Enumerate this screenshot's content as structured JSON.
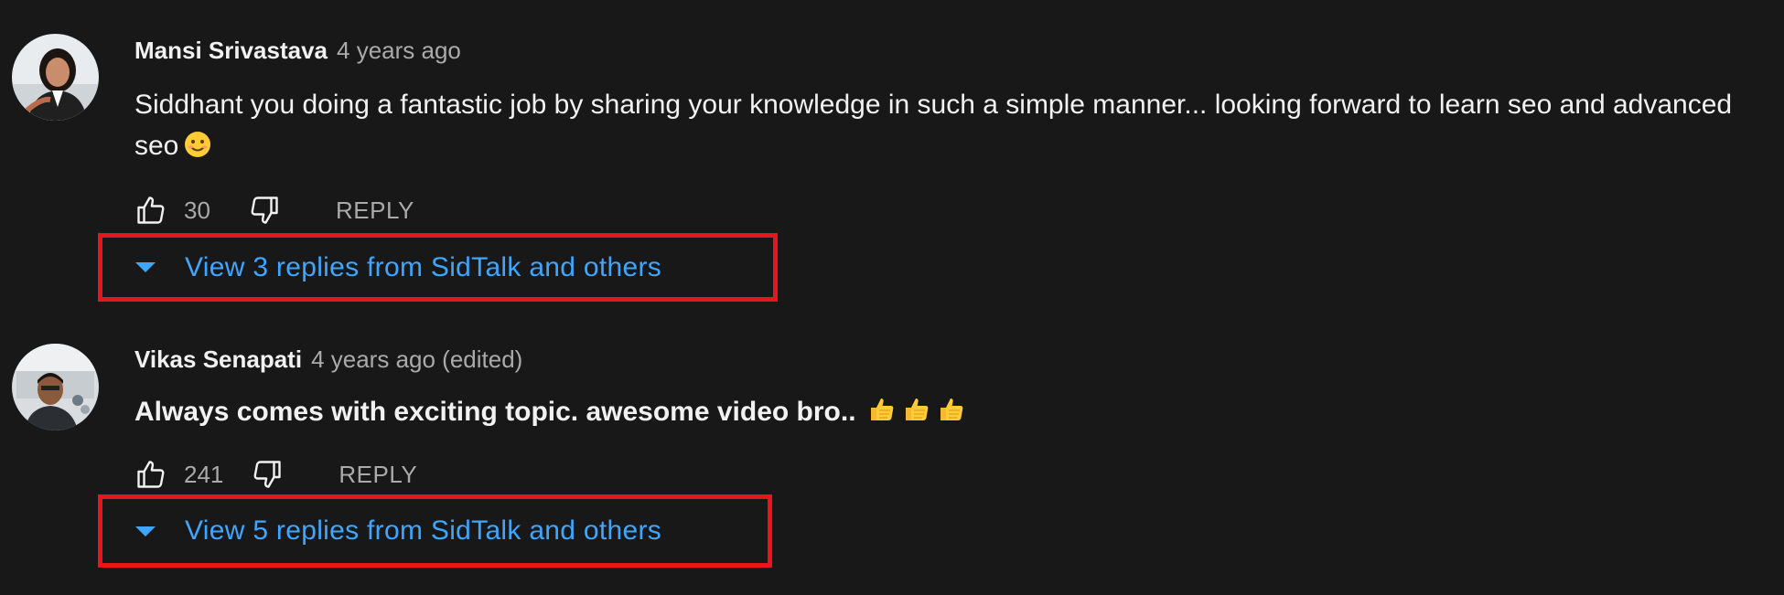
{
  "comments": [
    {
      "author": "Mansi Srivastava",
      "time": "4 years ago",
      "text": "Siddhant you doing a fantastic job by sharing your knowledge in such a simple manner... looking forward to learn seo and advanced seo",
      "emoji": "smiling-face-emoji",
      "likes": "30",
      "reply_label": "REPLY",
      "view_replies_label": "View 3 replies from SidTalk and others"
    },
    {
      "author": "Vikas Senapati",
      "time": "4 years ago (edited)",
      "text": "Always comes with exciting topic. awesome video bro..",
      "emoji": "thumbs-up-emoji",
      "likes": "241",
      "reply_label": "REPLY",
      "view_replies_label": "View 5 replies from SidTalk and others"
    }
  ],
  "colors": {
    "background": "#181818",
    "text_primary": "#f1f1f1",
    "text_secondary": "#aaaaaa",
    "link_blue": "#3ea6ff",
    "highlight_red": "#e8161c"
  },
  "icons": [
    "thumbs-up-outline-icon",
    "thumbs-down-outline-icon",
    "caret-down-icon"
  ]
}
